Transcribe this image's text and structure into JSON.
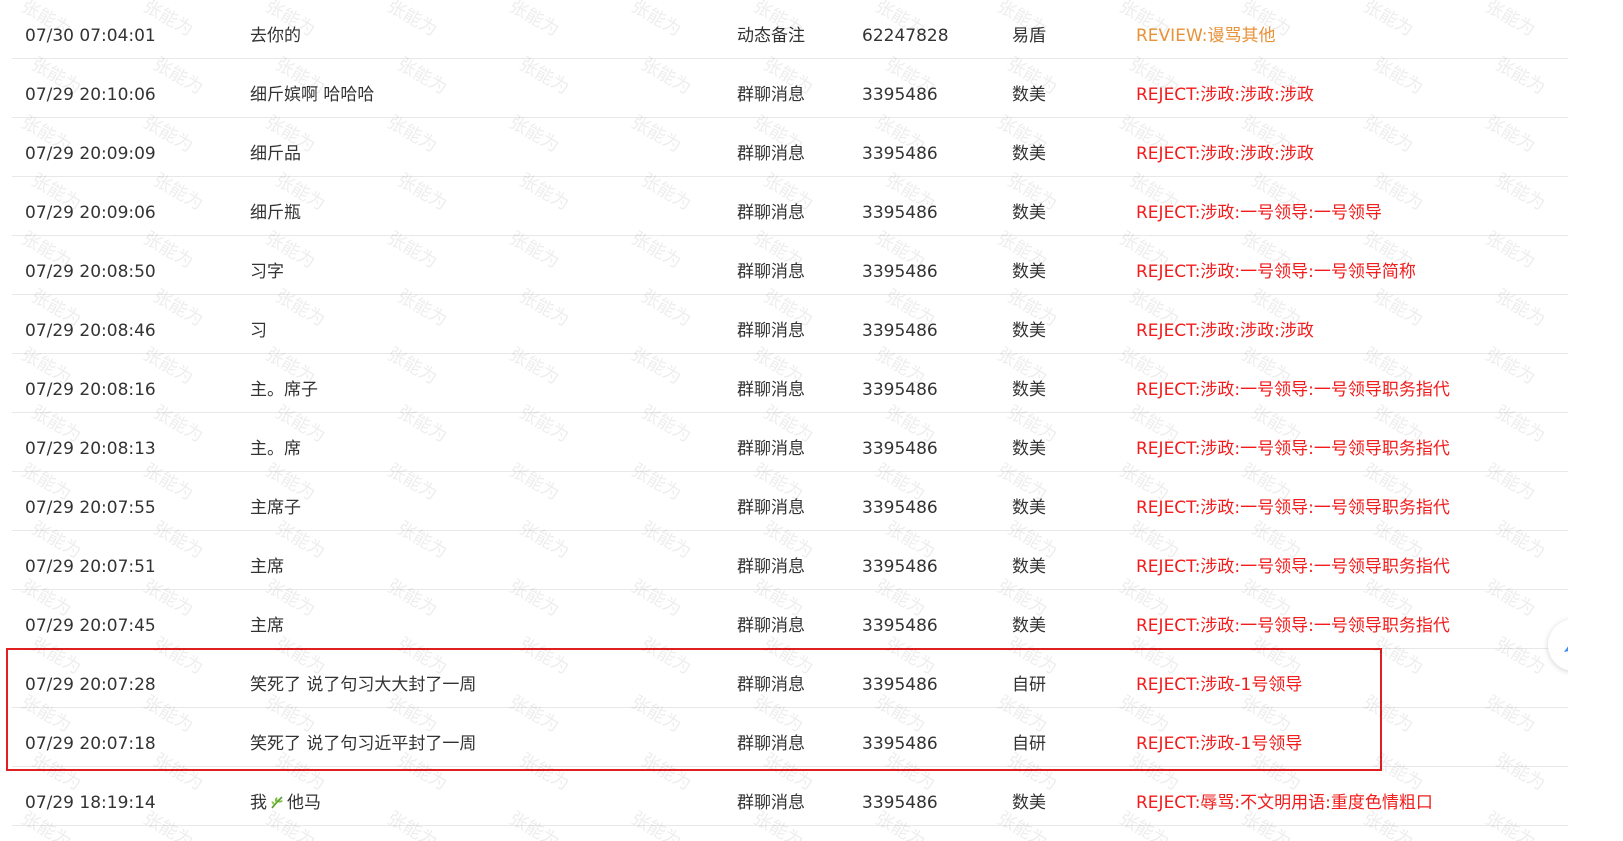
{
  "rows": [
    {
      "time": "07/30 07:04:01",
      "text": "去你的",
      "scene": "动态备注",
      "uid": "62247828",
      "source": "易盾",
      "result": "REVIEW:谩骂其他",
      "result_kind": "review"
    },
    {
      "time": "07/29 20:10:06",
      "text": "细斤嫔啊 哈哈哈",
      "scene": "群聊消息",
      "uid": "3395486",
      "source": "数美",
      "result": "REJECT:涉政:涉政:涉政",
      "result_kind": "reject"
    },
    {
      "time": "07/29 20:09:09",
      "text": "细斤品",
      "scene": "群聊消息",
      "uid": "3395486",
      "source": "数美",
      "result": "REJECT:涉政:涉政:涉政",
      "result_kind": "reject"
    },
    {
      "time": "07/29 20:09:06",
      "text": "细斤瓶",
      "scene": "群聊消息",
      "uid": "3395486",
      "source": "数美",
      "result": "REJECT:涉政:一号领导:一号领导",
      "result_kind": "reject"
    },
    {
      "time": "07/29 20:08:50",
      "text": "习字",
      "scene": "群聊消息",
      "uid": "3395486",
      "source": "数美",
      "result": "REJECT:涉政:一号领导:一号领导简称",
      "result_kind": "reject"
    },
    {
      "time": "07/29 20:08:46",
      "text": "习",
      "scene": "群聊消息",
      "uid": "3395486",
      "source": "数美",
      "result": "REJECT:涉政:涉政:涉政",
      "result_kind": "reject"
    },
    {
      "time": "07/29 20:08:16",
      "text": "主。席子",
      "scene": "群聊消息",
      "uid": "3395486",
      "source": "数美",
      "result": "REJECT:涉政:一号领导:一号领导职务指代",
      "result_kind": "reject"
    },
    {
      "time": "07/29 20:08:13",
      "text": "主。席",
      "scene": "群聊消息",
      "uid": "3395486",
      "source": "数美",
      "result": "REJECT:涉政:一号领导:一号领导职务指代",
      "result_kind": "reject"
    },
    {
      "time": "07/29 20:07:55",
      "text": "主席子",
      "scene": "群聊消息",
      "uid": "3395486",
      "source": "数美",
      "result": "REJECT:涉政:一号领导:一号领导职务指代",
      "result_kind": "reject"
    },
    {
      "time": "07/29 20:07:51",
      "text": "主席",
      "scene": "群聊消息",
      "uid": "3395486",
      "source": "数美",
      "result": "REJECT:涉政:一号领导:一号领导职务指代",
      "result_kind": "reject"
    },
    {
      "time": "07/29 20:07:45",
      "text": "主席",
      "scene": "群聊消息",
      "uid": "3395486",
      "source": "数美",
      "result": "REJECT:涉政:一号领导:一号领导职务指代",
      "result_kind": "reject"
    },
    {
      "time": "07/29 20:07:28",
      "text": "笑死了 说了句习大大封了一周",
      "scene": "群聊消息",
      "uid": "3395486",
      "source": "自研",
      "result": "REJECT:涉政-1号领导",
      "result_kind": "reject"
    },
    {
      "time": "07/29 20:07:18",
      "text": "笑死了 说了句习近平封了一周",
      "scene": "群聊消息",
      "uid": "3395486",
      "source": "自研",
      "result": "REJECT:涉政-1号领导",
      "result_kind": "reject"
    },
    {
      "time": "07/29 18:19:14",
      "text_before": "我",
      "text_icon": "herb-icon",
      "text_after": "他马",
      "scene": "群聊消息",
      "uid": "3395486",
      "source": "数美",
      "result": "REJECT:辱骂:不文明用语:重度色情粗口",
      "result_kind": "reject"
    }
  ],
  "watermark": "张能为",
  "floating_button": {
    "icon": "rocket-icon"
  },
  "colors": {
    "review": "#e8923a",
    "reject": "#f21c1c",
    "highlight": "#e02020",
    "rocket": "#3d8af7"
  }
}
